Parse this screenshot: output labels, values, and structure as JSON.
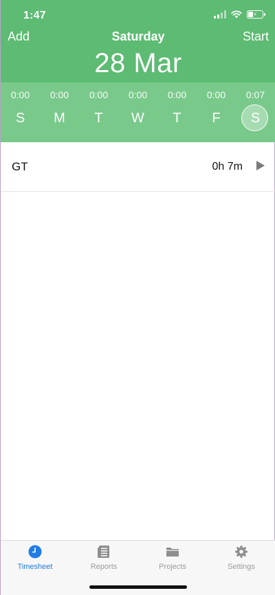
{
  "status": {
    "time": "1:47"
  },
  "nav": {
    "add": "Add",
    "title": "Saturday",
    "start": "Start"
  },
  "date": "28 Mar",
  "week": [
    {
      "letter": "S",
      "time": "0:00",
      "active": false
    },
    {
      "letter": "M",
      "time": "0:00",
      "active": false
    },
    {
      "letter": "T",
      "time": "0:00",
      "active": false
    },
    {
      "letter": "W",
      "time": "0:00",
      "active": false
    },
    {
      "letter": "T",
      "time": "0:00",
      "active": false
    },
    {
      "letter": "F",
      "time": "0:00",
      "active": false
    },
    {
      "letter": "S",
      "time": "0:07",
      "active": true
    }
  ],
  "entries": [
    {
      "name": "GT",
      "duration": "0h 7m"
    }
  ],
  "tabs": [
    {
      "label": "Timesheet",
      "icon": "clock-icon",
      "active": true
    },
    {
      "label": "Reports",
      "icon": "reports-icon",
      "active": false
    },
    {
      "label": "Projects",
      "icon": "folder-icon",
      "active": false
    },
    {
      "label": "Settings",
      "icon": "gear-icon",
      "active": false
    }
  ],
  "colors": {
    "header": "#5dbb73",
    "week": "#79c98b",
    "accent": "#1f7ce6"
  }
}
